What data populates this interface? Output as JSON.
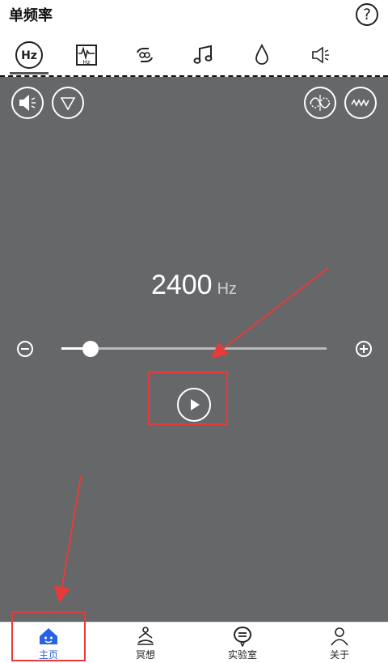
{
  "header": {
    "title": "单频率",
    "help_symbol": "?"
  },
  "tabs": [
    {
      "icon": "hz-icon",
      "label": "Hz",
      "active": true
    },
    {
      "icon": "waveform-hz-icon",
      "label": "Hz"
    },
    {
      "icon": "repeat-icon"
    },
    {
      "icon": "music-note-icon"
    },
    {
      "icon": "water-drop-icon"
    },
    {
      "icon": "speaker-muted-icon"
    }
  ],
  "controls": {
    "left": [
      "speaker-icon",
      "triangle-down-icon"
    ],
    "right": [
      "wave-inverse-icon",
      "wave-pattern-icon"
    ]
  },
  "frequency": {
    "value": "2400",
    "unit": "Hz"
  },
  "slider": {
    "fraction": 0.11
  },
  "bottom_nav": {
    "items": [
      {
        "label": "主页",
        "icon": "home-icon",
        "active": true
      },
      {
        "label": "冥想",
        "icon": "meditation-icon"
      },
      {
        "label": "实验室",
        "icon": "lab-chat-icon"
      },
      {
        "label": "关于",
        "icon": "person-icon"
      }
    ]
  },
  "colors": {
    "main_bg": "#666769",
    "accent": "#2a62e6",
    "annotation": "#e63b3b"
  }
}
